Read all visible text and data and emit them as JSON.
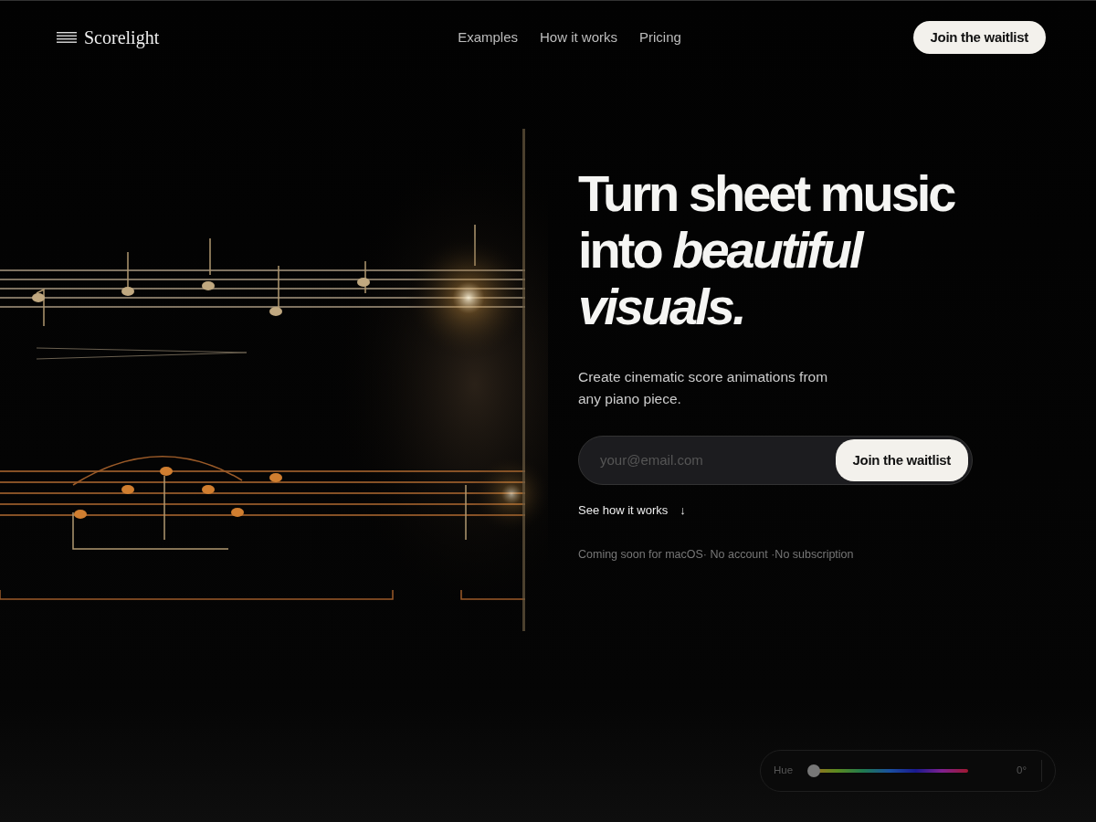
{
  "brand": {
    "name": "Scorelight"
  },
  "nav": {
    "links": [
      {
        "label": "Examples"
      },
      {
        "label": "How it works"
      },
      {
        "label": "Pricing"
      }
    ],
    "cta": "Join the waitlist"
  },
  "hero": {
    "headline": "Turn sheet music into *beautiful visuals.*",
    "subtitle": "Create cinematic score animations from any piano piece.",
    "email": {
      "placeholder": "your@email.com"
    },
    "submit": "Join the waitlist",
    "secondary_link": {
      "label": "See how it works",
      "icon": "↓"
    },
    "note": "Coming soon for macOS· No account ·No subscription"
  },
  "hue_control": {
    "label": "Hue",
    "level": 0,
    "reading": "0°"
  }
}
